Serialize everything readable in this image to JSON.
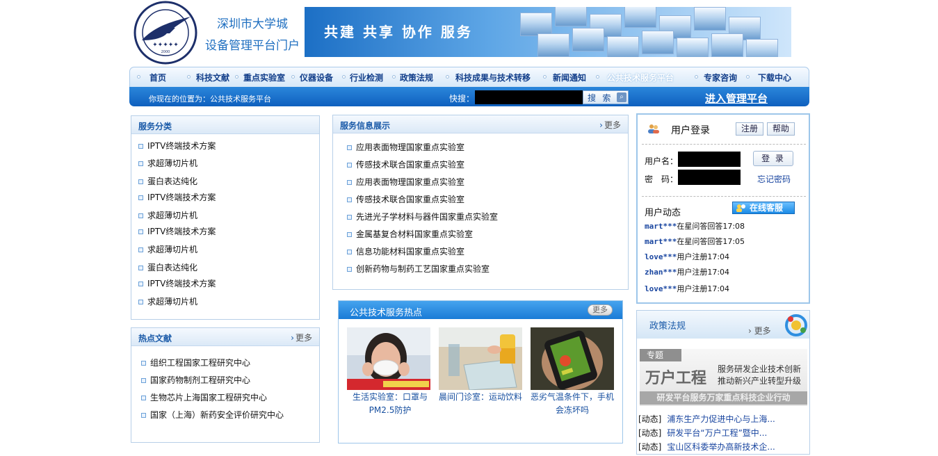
{
  "header": {
    "logo_text": "UNIVERSITY TOWN OF SHENZHEN 深圳大学城 2000",
    "title_line1": "深圳市大学城",
    "title_line2": "设备管理平台门户",
    "banner_slogan": "共建 共享 协作 服务"
  },
  "nav": {
    "items": [
      "首页",
      "科技文献",
      "重点实验室",
      "仪器设备",
      "行业检测",
      "政策法规",
      "科技成果与技术转移",
      "新闻通知",
      "公共技术服务平台",
      "专家咨询",
      "下载中心"
    ]
  },
  "location_bar": {
    "location_text": "你现在的位置为：公共技术服务平台",
    "quick_label": "快搜：",
    "search_label": "搜 索",
    "admin_link": "进入管理平台"
  },
  "service_categories": {
    "title": "服务分类",
    "items": [
      "IPTV终端技术方案",
      "求超薄切片机",
      "蛋白表达纯化",
      "IPTV终端技术方案",
      "求超薄切片机",
      "IPTV终端技术方案",
      "求超薄切片机",
      "蛋白表达纯化",
      "IPTV终端技术方案",
      "求超薄切片机"
    ]
  },
  "hot_literature": {
    "title": "热点文献",
    "more": "更多",
    "items": [
      "组织工程国家工程研究中心",
      "国家药物制剂工程研究中心",
      "生物芯片上海国家工程研究中心",
      "国家（上海）新药安全评价研究中心"
    ]
  },
  "service_info": {
    "title": "服务信息展示",
    "more": "更多",
    "items": [
      "应用表面物理国家重点实验室",
      "传感技术联合国家重点实验室",
      "应用表面物理国家重点实验室",
      "传感技术联合国家重点实验室",
      "先进光子学材料与器件国家重点实验室",
      "金属基复合材料国家重点实验室",
      "信息功能材料国家重点实验室",
      "创新药物与制药工艺国家重点实验室"
    ]
  },
  "hot_services": {
    "title": "公共技术服务热点",
    "more": "更多",
    "cards": [
      {
        "caption_line1": "生活实验室：口罩与",
        "caption_line2": "PM2.5防护"
      },
      {
        "caption_line1": "晨间门诊室：运动饮料",
        "caption_line2": ""
      },
      {
        "caption_line1": "恶劣气温条件下，手机",
        "caption_line2": "会冻坏吗"
      }
    ]
  },
  "login": {
    "title": "用户登录",
    "register": "注册",
    "help": "帮助",
    "username_label": "用户名：",
    "password_label": "密　码：",
    "login_button": "登 录",
    "forgot": "忘记密码",
    "activity_title": "用户动态",
    "online_service": "在线客服",
    "activities": [
      {
        "user": "mart***",
        "text": "在星问答回答17:08"
      },
      {
        "user": "mart***",
        "text": "在星问答回答17:05"
      },
      {
        "user": "love***",
        "text": "用户注册17:04"
      },
      {
        "user": "zhan***",
        "text": "用户注册17:04"
      },
      {
        "user": "love***",
        "text": "用户注册17:04"
      }
    ]
  },
  "policy": {
    "title": "政策法规",
    "more": "更多",
    "promo_tag": "专题",
    "promo_title": "万户工程",
    "promo_line1": "服务研发企业技术创新",
    "promo_line2": "推动新兴产业转型升级",
    "promo_footer": "研发平台服务万家重点科技企业行动",
    "news": [
      {
        "tag": "[动态]",
        "text": "浦东生产力促进中心与上海..."
      },
      {
        "tag": "[动态]",
        "text": "研发平台“万户工程”暨中..."
      },
      {
        "tag": "[动态]",
        "text": "宝山区科委举办高新技术企..."
      }
    ]
  },
  "colors": {
    "brand_blue": "#1a7bd6",
    "link_blue": "#1a46a0",
    "panel_border": "#b7cfe8"
  }
}
